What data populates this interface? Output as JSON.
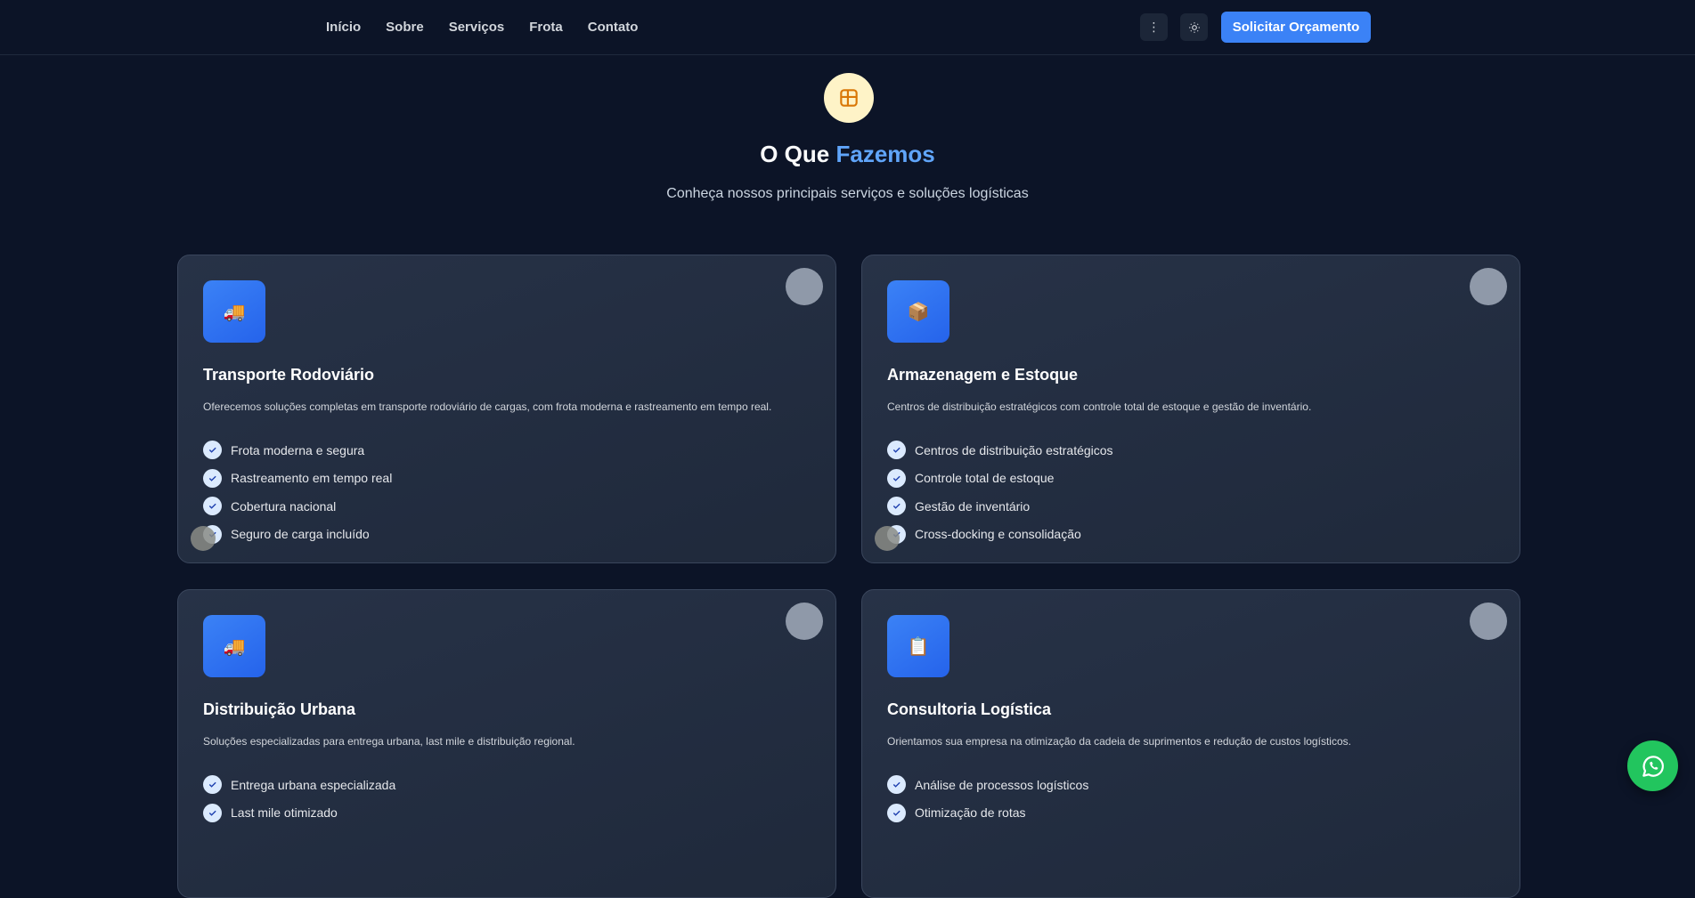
{
  "nav": {
    "items": [
      "Início",
      "Sobre",
      "Serviços",
      "Frota",
      "Contato"
    ]
  },
  "header": {
    "more_icon": "more-vertical-icon",
    "theme_icon": "sun-icon",
    "cta_label": "Solicitar Orçamento"
  },
  "section": {
    "icon": "package-icon",
    "title_main": "O Que ",
    "title_accent": "Fazemos",
    "subtitle": "Conheça nossos principais serviços e soluções logísticas"
  },
  "cards": [
    {
      "icon": "🚚",
      "title": "Transporte Rodoviário",
      "description": "Oferecemos soluções completas em transporte rodoviário de cargas, com frota moderna e rastreamento em tempo real.",
      "features": [
        "Frota moderna e segura",
        "Rastreamento em tempo real",
        "Cobertura nacional",
        "Seguro de carga incluído"
      ]
    },
    {
      "icon": "📦",
      "title": "Armazenagem e Estoque",
      "description": "Centros de distribuição estratégicos com controle total de estoque e gestão de inventário.",
      "features": [
        "Centros de distribuição estratégicos",
        "Controle total de estoque",
        "Gestão de inventário",
        "Cross-docking e consolidação"
      ]
    },
    {
      "icon": "🚚",
      "title": "Distribuição Urbana",
      "description": "Soluções especializadas para entrega urbana, last mile e distribuição regional.",
      "features": [
        "Entrega urbana especializada",
        "Last mile otimizado"
      ]
    },
    {
      "icon": "📋",
      "title": "Consultoria Logística",
      "description": "Orientamos sua empresa na otimização da cadeia de suprimentos e redução de custos logísticos.",
      "features": [
        "Análise de processos logísticos",
        "Otimização de rotas"
      ]
    }
  ],
  "colors": {
    "background": "#0c1427",
    "accent": "#3b82f6",
    "accent_text": "#60a5fa",
    "whatsapp": "#22c55e"
  },
  "floating": {
    "whatsapp_icon": "whatsapp-icon"
  }
}
